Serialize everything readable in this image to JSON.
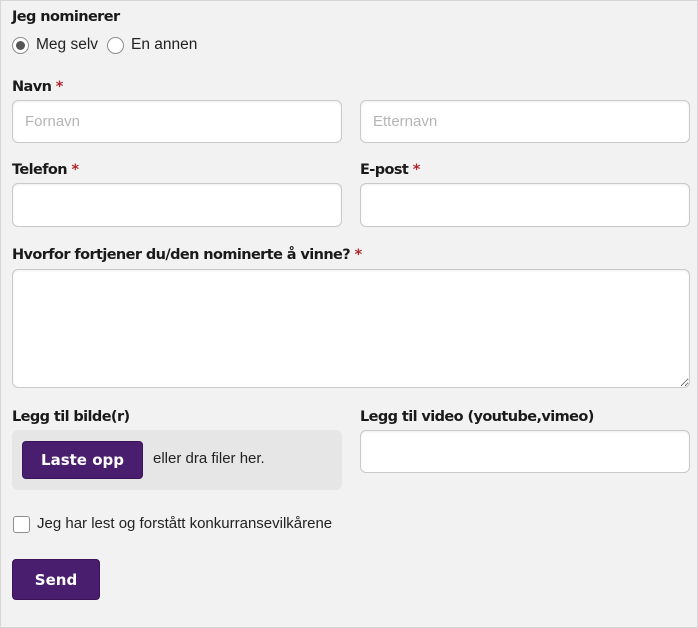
{
  "form": {
    "nominate": {
      "label": "Jeg nominerer",
      "options": [
        "Meg selv",
        "En annen"
      ],
      "selected": "Meg selv"
    },
    "name": {
      "label": "Navn",
      "required_mark": "*",
      "first_placeholder": "Fornavn",
      "last_placeholder": "Etternavn"
    },
    "phone": {
      "label": "Telefon",
      "required_mark": "*"
    },
    "email": {
      "label": "E-post",
      "required_mark": "*"
    },
    "reason": {
      "label": "Hvorfor fortjener du/den nominerte å vinne?",
      "required_mark": "*"
    },
    "image": {
      "label": "Legg til bilde(r)",
      "button": "Laste opp",
      "hint": "eller dra filer her."
    },
    "video": {
      "label": "Legg til video (youtube,vimeo)"
    },
    "terms": {
      "label": "Jeg har lest og forstått konkurransevilkårene",
      "checked": false
    },
    "submit": "Send"
  },
  "colors": {
    "accent": "#4a1e6e",
    "required": "#b0262c",
    "background": "#f2f2f2"
  }
}
